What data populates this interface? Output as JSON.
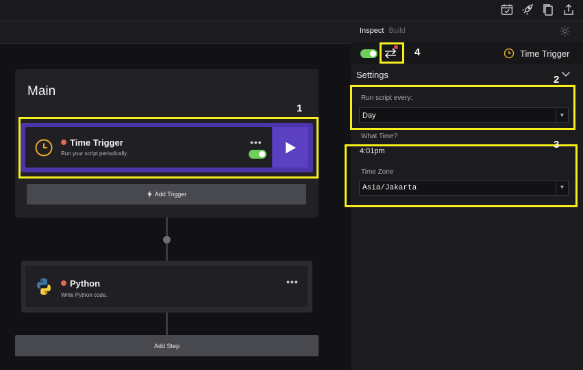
{
  "canvas": {
    "flow_title": "Main",
    "trigger": {
      "title": "Time Trigger",
      "description": "Run your script periodically.",
      "menu": "•••"
    },
    "add_trigger_label": "Add Trigger",
    "python": {
      "title": "Python",
      "description": "Write Python code.",
      "menu": "•••"
    },
    "add_step_label": "Add Step"
  },
  "inspector": {
    "tabs": [
      "Inspect",
      "Build"
    ],
    "header_title": "Time Trigger",
    "settings_label": "Settings",
    "run_every_label": "Run script every:",
    "run_every_value": "Day",
    "what_time_label": "What Time?",
    "what_time_value": "4:01pm",
    "timezone_label": "Time Zone",
    "timezone_value": "Asia/Jakarta"
  },
  "annotations": [
    "1",
    "2",
    "3",
    "4"
  ],
  "colors": {
    "accent": "#4c35a8",
    "highlight": "#f6ef1d",
    "toggle_on": "#6fcf5a",
    "status_dot": "#e06a4d",
    "clock": "#e8a829"
  },
  "icons": [
    "todo-icon",
    "rocket-icon",
    "copy-icon",
    "share-icon",
    "gear-icon",
    "swap-icon",
    "clock-icon",
    "python-icon",
    "play-icon",
    "bolt-icon",
    "chevron-down-icon"
  ]
}
